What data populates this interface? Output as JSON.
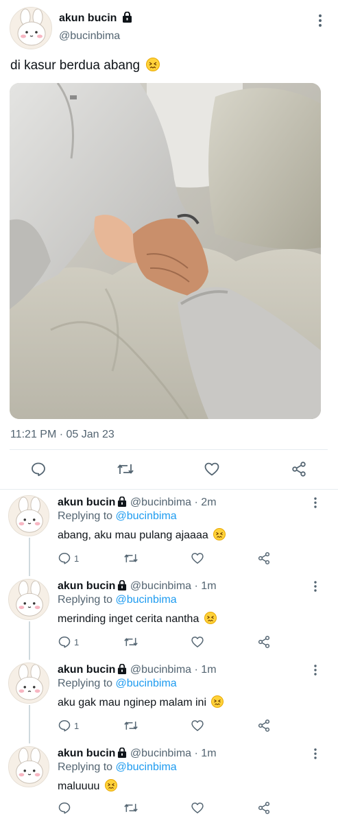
{
  "tweet": {
    "author_name": "akun bucin",
    "author_handle": "@bucinbima",
    "text": "di kasur berdua abang",
    "timestamp": "11:21 PM · 05 Jan 23",
    "actions": [
      "reply-icon",
      "retweet-icon",
      "like-icon",
      "share-icon"
    ]
  },
  "replies": [
    {
      "author_name": "akun bucin",
      "author_handle": "@bucinbima",
      "time": "· 2m",
      "replying_label": "Replying to",
      "replying_to": "@bucinbima",
      "text": "abang, aku mau pulang ajaaaa",
      "reply_count": "1"
    },
    {
      "author_name": "akun bucin",
      "author_handle": "@bucinbima",
      "time": "· 1m",
      "replying_label": "Replying to",
      "replying_to": "@bucinbima",
      "text": "merinding inget cerita nantha",
      "reply_count": "1"
    },
    {
      "author_name": "akun bucin",
      "author_handle": "@bucinbima",
      "time": "· 1m",
      "replying_label": "Replying to",
      "replying_to": "@bucinbima",
      "text": "aku gak mau nginep malam ini",
      "reply_count": "1"
    },
    {
      "author_name": "akun bucin",
      "author_handle": "@bucinbima",
      "time": "· 1m",
      "replying_label": "Replying to",
      "replying_to": "@bucinbima",
      "text": "maluuuu",
      "reply_count": ""
    }
  ],
  "colors": {
    "link": "#1d9bf0",
    "secondary_text": "#536471",
    "divider": "#e6ecf0"
  }
}
